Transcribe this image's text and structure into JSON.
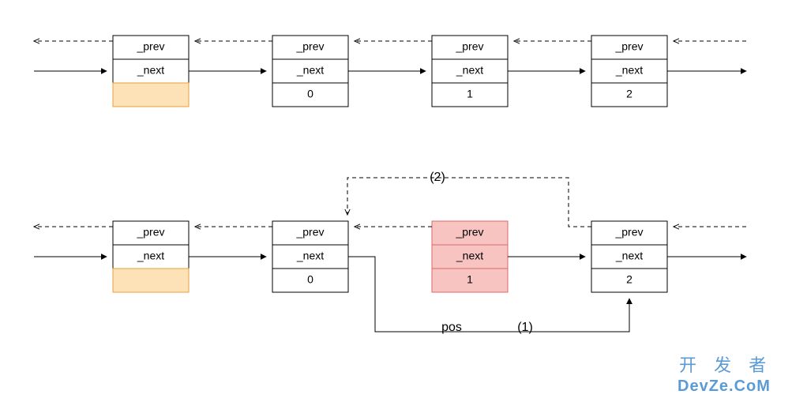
{
  "labels": {
    "prev": "_prev",
    "next": "_next",
    "pos": "pos",
    "step1": "(1)",
    "step2": "(2)"
  },
  "top_row": {
    "nodes": [
      {
        "value": "",
        "highlight": "orange"
      },
      {
        "value": "0",
        "highlight": "none"
      },
      {
        "value": "1",
        "highlight": "none"
      },
      {
        "value": "2",
        "highlight": "none"
      }
    ]
  },
  "bottom_row": {
    "nodes": [
      {
        "value": "",
        "highlight": "orange"
      },
      {
        "value": "0",
        "highlight": "none"
      },
      {
        "value": "1",
        "highlight": "red"
      },
      {
        "value": "2",
        "highlight": "none"
      }
    ]
  },
  "watermark": {
    "line1": "开 发 者",
    "line2": "DevZe.CoM"
  }
}
